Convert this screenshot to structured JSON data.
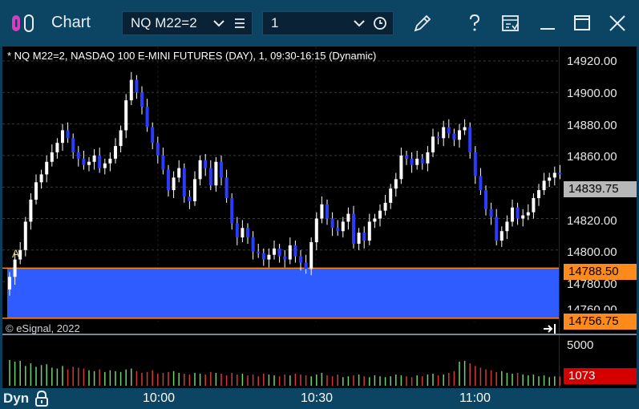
{
  "window": {
    "title": "Chart",
    "symbol": "NQ M22=2",
    "interval": "1",
    "icons": [
      "app-logo-icon",
      "chevron-down-icon",
      "menu-lines-icon",
      "chevron-down-icon",
      "clock-icon",
      "pencil-icon",
      "help-icon",
      "save-window-icon",
      "minimize-icon",
      "maximize-icon",
      "close-icon"
    ]
  },
  "chart": {
    "header": "* NQ M22=2, NASDAQ 100 E-MINI FUTURES (DAY), 1, 09:30-16:15 (Dynamic)",
    "copyright": "© eSignal, 2022",
    "marker": "A",
    "price_labels": [
      "14920.00",
      "14900.00",
      "14880.00",
      "14860.00",
      "14820.00",
      "14800.00",
      "14780.00"
    ],
    "price_partial": "14760.00",
    "last_price": "14839.75",
    "range_high": "14788.50",
    "range_low": "14756.75",
    "volume_scale": "5000",
    "last_volume": "1073",
    "time_labels": [
      "10:00",
      "10:30",
      "11:00"
    ],
    "mode": "Dyn",
    "colors": {
      "up_candle": "#ffffff",
      "down_candle": "#2b3bff",
      "range_fill": "#2f5cff",
      "range_line": "#ff8a1c",
      "tag_orange": "#ff8a1c",
      "tag_gray": "#b8b8b8",
      "tag_red": "#d40000",
      "vol_up": "#6fd36f",
      "vol_down": "#d23a3a"
    }
  },
  "chart_data": {
    "type": "candlestick",
    "title": "* NQ M22=2, NASDAQ 100 E-MINI FUTURES (DAY), 1, 09:30-16:15 (Dynamic)",
    "ylim": [
      14756,
      14930
    ],
    "x": [
      "9:31",
      "9:32",
      "9:33",
      "9:34",
      "9:35",
      "9:36",
      "9:37",
      "9:38",
      "9:39",
      "9:40",
      "9:41",
      "9:42",
      "9:43",
      "9:44",
      "9:45",
      "9:46",
      "9:47",
      "9:48",
      "9:49",
      "9:50",
      "9:51",
      "9:52",
      "9:53",
      "9:54",
      "9:55",
      "9:56",
      "9:57",
      "9:58",
      "9:59",
      "10:00",
      "10:01",
      "10:02",
      "10:03",
      "10:04",
      "10:05",
      "10:06",
      "10:07",
      "10:08",
      "10:09",
      "10:10",
      "10:11",
      "10:12",
      "10:13",
      "10:14",
      "10:15",
      "10:16",
      "10:17",
      "10:18",
      "10:19",
      "10:20",
      "10:21",
      "10:22",
      "10:23",
      "10:24",
      "10:25",
      "10:26",
      "10:27",
      "10:28",
      "10:29",
      "10:30",
      "10:31",
      "10:32",
      "10:33",
      "10:34",
      "10:35",
      "10:36",
      "10:37",
      "10:38",
      "10:39",
      "10:40",
      "10:41",
      "10:42",
      "10:43",
      "10:44",
      "10:45",
      "10:46",
      "10:47",
      "10:48",
      "10:49",
      "10:50",
      "10:51",
      "10:52",
      "10:53",
      "10:54",
      "10:55",
      "10:56",
      "10:57",
      "10:58",
      "10:59",
      "11:00",
      "11:01",
      "11:02",
      "11:03",
      "11:04",
      "11:05",
      "11:06",
      "11:07",
      "11:08",
      "11:09",
      "11:10",
      "11:11",
      "11:12",
      "11:13",
      "11:14",
      "11:15"
    ],
    "open": [
      14775,
      14783,
      14794,
      14800,
      14818,
      14832,
      14843,
      14848,
      14856,
      14862,
      14868,
      14876,
      14871,
      14862,
      14858,
      14854,
      14856,
      14860,
      14852,
      14855,
      14858,
      14866,
      14876,
      14895,
      14908,
      14900,
      14891,
      14878,
      14868,
      14860,
      14851,
      14838,
      14846,
      14852,
      14834,
      14831,
      14845,
      14857,
      14852,
      14841,
      14856,
      14846,
      14833,
      14817,
      14808,
      14814,
      14808,
      14799,
      14798,
      14794,
      14797,
      14801,
      14796,
      14794,
      14803,
      14796,
      14792,
      14788,
      14805,
      14820,
      14829,
      14820,
      14814,
      14812,
      14818,
      14823,
      14804,
      14811,
      14806,
      14818,
      14820,
      14825,
      14830,
      14839,
      14845,
      14860,
      14858,
      14854,
      14858,
      14855,
      14862,
      14872,
      14871,
      14878,
      14874,
      14870,
      14876,
      14878,
      14862,
      14847,
      14838,
      14826,
      14821,
      14806,
      14812,
      14818,
      14827,
      14820,
      14822,
      14824,
      14833,
      14838,
      14844,
      14846,
      14849
    ],
    "close": [
      14783,
      14794,
      14800,
      14818,
      14832,
      14843,
      14848,
      14856,
      14862,
      14868,
      14876,
      14871,
      14862,
      14858,
      14854,
      14856,
      14860,
      14852,
      14855,
      14858,
      14866,
      14876,
      14895,
      14908,
      14900,
      14891,
      14878,
      14868,
      14860,
      14851,
      14838,
      14846,
      14852,
      14834,
      14831,
      14845,
      14857,
      14852,
      14841,
      14856,
      14846,
      14833,
      14817,
      14808,
      14814,
      14808,
      14799,
      14798,
      14794,
      14797,
      14801,
      14796,
      14794,
      14803,
      14796,
      14792,
      14788,
      14805,
      14820,
      14829,
      14820,
      14814,
      14812,
      14818,
      14823,
      14804,
      14811,
      14806,
      14818,
      14820,
      14825,
      14830,
      14839,
      14845,
      14860,
      14858,
      14854,
      14858,
      14855,
      14862,
      14872,
      14871,
      14878,
      14874,
      14870,
      14876,
      14878,
      14862,
      14847,
      14838,
      14826,
      14821,
      14806,
      14812,
      14818,
      14827,
      14820,
      14822,
      14824,
      14833,
      14838,
      14844,
      14846,
      14849,
      14848
    ],
    "volume": [
      3000,
      2800,
      2900,
      2300,
      2600,
      2200,
      2400,
      2500,
      2100,
      2000,
      2300,
      1900,
      2200,
      2100,
      2000,
      1800,
      1700,
      1900,
      1600,
      1800,
      1700,
      1600,
      1900,
      2000,
      1700,
      1500,
      1600,
      1800,
      1400,
      1500,
      1600,
      1700,
      1500,
      1400,
      1300,
      1500,
      1400,
      1300,
      1600,
      1500,
      1400,
      1200,
      1500,
      1300,
      1400,
      1200,
      1300,
      1100,
      1400,
      1300,
      1200,
      1100,
      1300,
      1200,
      1400,
      1300,
      1200,
      1100,
      1300,
      1500,
      1200,
      1100,
      1300,
      1000,
      1100,
      1200,
      1300,
      1100,
      1000,
      1200,
      1100,
      1000,
      1100,
      1300,
      1200,
      1100,
      1000,
      1200,
      1100,
      1300,
      1400,
      1200,
      1300,
      1500,
      1700,
      2800,
      2900,
      2600,
      2300,
      2100,
      1900,
      1800,
      1600,
      1700,
      1500,
      1400,
      1500,
      1300,
      1200,
      1300,
      1100,
      1200,
      1000,
      1100,
      1073
    ],
    "volume_ylim": [
      0,
      5500
    ],
    "last_price": 14839.75,
    "range": [
      14756.75,
      14788.5
    ]
  }
}
